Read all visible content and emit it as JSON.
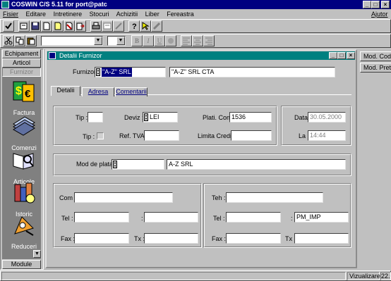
{
  "titlebar": {
    "title": "COSWIN C/S 5.11 for port@patc",
    "min": "_",
    "max": "□",
    "close": "×"
  },
  "menu": {
    "items": [
      {
        "id": "fisier",
        "label": "Fisier"
      },
      {
        "id": "editare",
        "label": "Editare"
      },
      {
        "id": "intretinere",
        "label": "Intretinere"
      },
      {
        "id": "stocuri",
        "label": "Stocuri"
      },
      {
        "id": "achizitii",
        "label": "Achizitii"
      },
      {
        "id": "liber",
        "label": "Liber"
      },
      {
        "id": "fereastra",
        "label": "Fereastra"
      }
    ],
    "help": "Ajutor"
  },
  "toolbar2": {
    "font_btns": [
      "B",
      "I",
      "U"
    ]
  },
  "left_nav": {
    "tabs": [
      {
        "label": "Echipament"
      },
      {
        "label": "Articol"
      },
      {
        "label": "Furnizor"
      }
    ],
    "modules": [
      {
        "label": "Factura",
        "icon": "invoice-icon"
      },
      {
        "label": "Comenzi",
        "icon": "orders-icon"
      },
      {
        "label": "Articole",
        "icon": "articles-icon"
      },
      {
        "label": "Istoric",
        "icon": "history-icon"
      },
      {
        "label": "Reduceri",
        "icon": "discounts-icon"
      }
    ],
    "module_label": "Module"
  },
  "right_buttons": [
    "Mod. Cod",
    "Mod. Pret"
  ],
  "window": {
    "title": "Detalii Furnizor",
    "min": "_",
    "max": "□",
    "close": "×"
  },
  "form": {
    "furnizor_label": "Furnizor :",
    "furnizor_code": "\"A-Z\" SRL",
    "furnizor_name": "\"A-Z\" SRL CTA",
    "tabs": [
      "Detalii",
      "Adresa",
      "Comentarii"
    ],
    "tip_label": "Tip :",
    "tip_value": "",
    "tip2_label": "Tip :",
    "deviz_label": "Deviz :",
    "deviz_value": "LEI",
    "ref_tva_label": "Ref. TVA:",
    "ref_tva_value": "",
    "plati_cont_label": "Plati. Cont :",
    "plati_cont_value": "1536",
    "limita_credit_label": "Limita Credit :",
    "limita_credit_value": "",
    "data_label": "Data :",
    "data_value": "30.05.2000",
    "la_label": "La :",
    "la_value": "14:44",
    "mod_plata_label": "Mod de plata :",
    "mod_plata_code": "",
    "mod_plata_name": "A-Z SRL",
    "com_label": "Com :",
    "com_value": "",
    "tel1_label": "Tel :",
    "tel1_value": "",
    "tel1_ext": "",
    "fax1_label": "Fax :",
    "fax1_value": "",
    "tx1_label": "Tx :",
    "tx1_value": "",
    "teh_label": "Teh :",
    "teh_value": "",
    "tel2_label": "Tel :",
    "tel2_value": "",
    "tel2_ext": "PM_IMP",
    "fax2_label": "Fax :",
    "fax2_value": "",
    "tx2_label": "Tx :",
    "tx2_value": ""
  },
  "status": {
    "mode": "Vizualizare",
    "zoom": "22.0"
  },
  "colors": {
    "titlebar": "#000080",
    "face": "#c0c0c0",
    "workspace": "#008080"
  }
}
